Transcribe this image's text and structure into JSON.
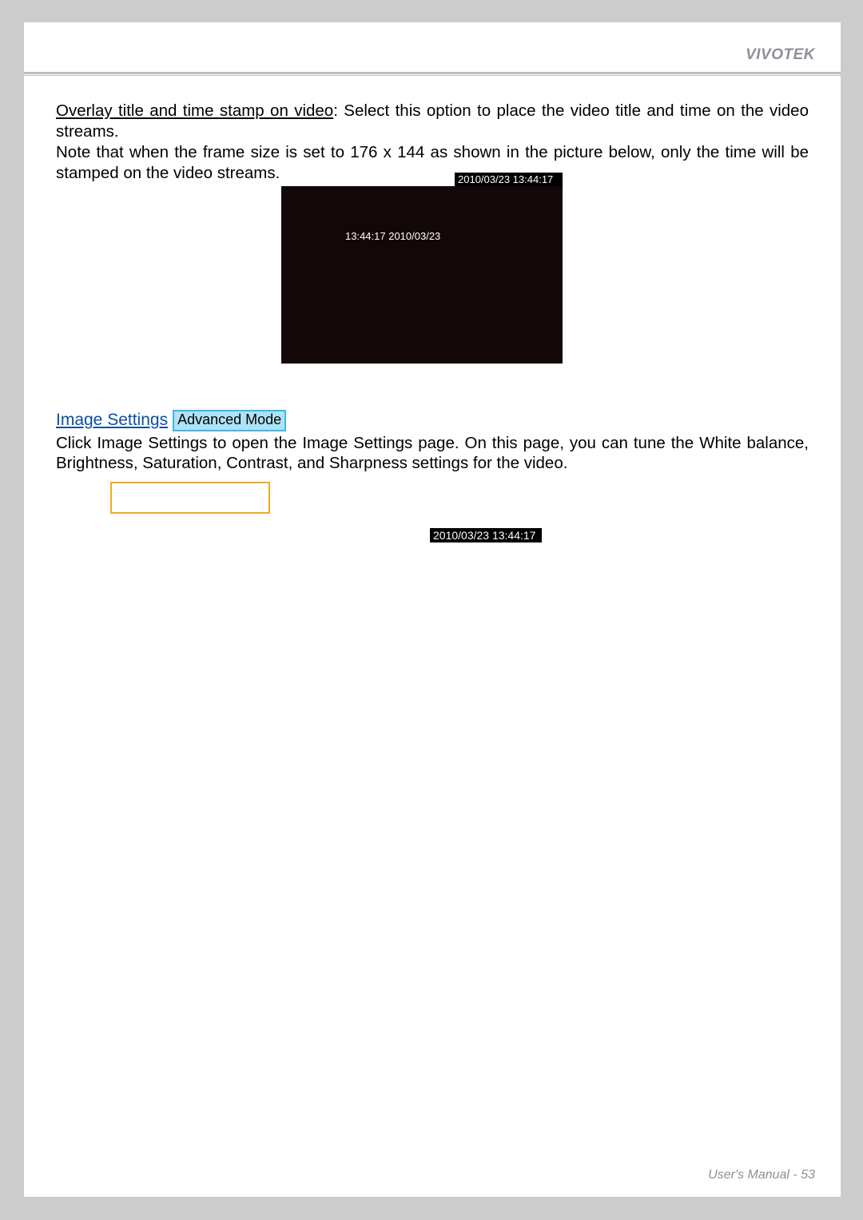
{
  "brand": "VIVOTEK",
  "para1_underline": "Overlay title and time stamp on video",
  "para1_rest": ": Select this option to place the video title and time on the video streams.",
  "para2": "Note that when the frame size is set to 176 x 144 as shown in the picture below, only the time will be stamped on the video streams.",
  "timestamp_bar_1": "2010/03/23 13:44:17",
  "video_overlay_text": "13:44:17 2010/03/23",
  "image_settings_link": "Image Settings",
  "advanced_mode_badge": "Advanced Mode",
  "para3": "Click Image Settings  to open the Image Settings page. On this page, you can tune the White balance, Brightness, Saturation, Contrast, and Sharpness settings for the video.",
  "timestamp_bar_2": "2010/03/23 13:44:17",
  "footer": "User's Manual - 53"
}
